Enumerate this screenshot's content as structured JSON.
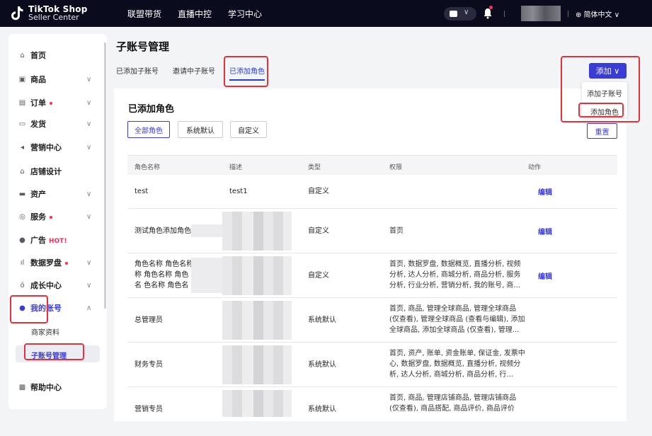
{
  "header": {
    "logo_title": "TikTok Shop",
    "logo_sub": "Seller Center",
    "nav": [
      "联盟带货",
      "直播中控",
      "学习中心"
    ],
    "lang": "⊕ 简体中文 ∨"
  },
  "sidebar": {
    "items": [
      {
        "label": "首页",
        "icon": "home-icon"
      },
      {
        "label": "商品",
        "icon": "product-icon"
      },
      {
        "label": "订单",
        "icon": "order-icon"
      },
      {
        "label": "发货",
        "icon": "shipping-icon"
      },
      {
        "label": "营销中心",
        "icon": "megaphone-icon"
      },
      {
        "label": "店铺设计",
        "icon": "store-icon"
      },
      {
        "label": "资产",
        "icon": "wallet-icon"
      },
      {
        "label": "服务",
        "icon": "service-icon"
      },
      {
        "label": "广告",
        "icon": "ads-icon",
        "badge": "HOT!"
      },
      {
        "label": "数据罗盘",
        "icon": "chart-icon"
      },
      {
        "label": "成长中心",
        "icon": "growth-icon"
      },
      {
        "label": "我的账号",
        "icon": "user-icon"
      },
      {
        "label": "帮助中心",
        "icon": "help-icon"
      }
    ],
    "sub_items": [
      "商家资料",
      "子账号管理"
    ]
  },
  "page": {
    "title": "子账号管理",
    "tabs": [
      "已添加子账号",
      "邀请中子账号",
      "已添加角色"
    ],
    "add_button": "添加 ∨",
    "dropdown": [
      "添加子账号",
      "添加角色"
    ]
  },
  "card": {
    "title": "已添加角色",
    "filters": [
      "全部角色",
      "系统默认",
      "自定义"
    ],
    "reset": "重置"
  },
  "table": {
    "columns": [
      "角色名称",
      "描述",
      "类型",
      "权限",
      "动作"
    ],
    "edit_label": "编辑",
    "rows": [
      {
        "name": "test",
        "desc": "test1",
        "type": "自定义",
        "perm": "",
        "edit": true
      },
      {
        "name": "测试角色添加角色",
        "desc": "",
        "type": "自定义",
        "perm": "首页",
        "edit": true
      },
      {
        "name": "角色名称 角色名称 称 角色名称 角色名 色名称 角色名称 角",
        "desc": "",
        "type": "自定义",
        "perm": "首页, 数据罗盘, 数据概览, 直播分析, 视频分析, 达人分析, 商城分析, 商品分析, 服务分析, 行业分析, 营销分析, 我的账号, 商...",
        "edit": true
      },
      {
        "name": "总管理员",
        "desc": "",
        "type": "系统默认",
        "perm": "首页, 商品, 管理全球商品, 管理全球商品 (仅查看), 管理全球商品 (查看与编辑), 添加全球商品, 添加全球商品 (仅查看), 管理...",
        "edit": false
      },
      {
        "name": "财务专员",
        "desc": "",
        "type": "系统默认",
        "perm": "首页, 资产, 账单, 资金账单, 保证金, 发票中心, 数据罗盘, 数据概览, 直播分析, 视频分析, 达人分析, 商城分析, 商品分析, 行...",
        "edit": false
      },
      {
        "name": "营销专员",
        "desc": "",
        "type": "系统默认",
        "perm": "首页, 商品, 管理店铺商品, 管理店铺商品 (仅查看), 商品搭配, 商品评价, 商品评价",
        "edit": false
      }
    ]
  },
  "colors": {
    "accent": "#3a3cd6",
    "highlight": "#e8303a",
    "topbar": "#0b0b1e"
  }
}
